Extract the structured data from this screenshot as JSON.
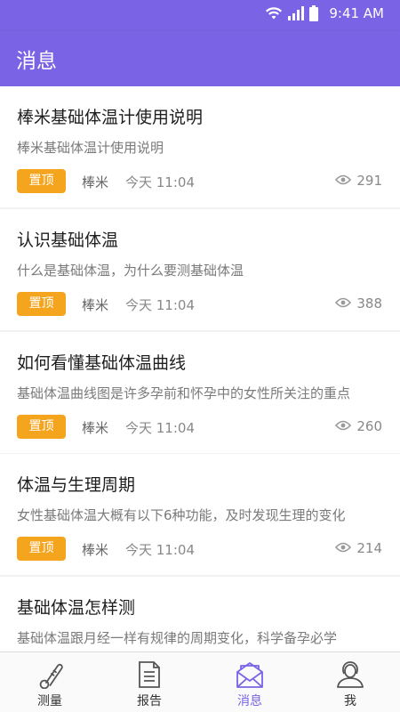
{
  "status_bar": {
    "time": "9:41 AM"
  },
  "header": {
    "title": "消息"
  },
  "articles": [
    {
      "title": "棒米基础体温计使用说明",
      "summary": "棒米基础体温计使用说明",
      "tag": "置顶",
      "author": "棒米",
      "time": "今天 11:04",
      "views": "291"
    },
    {
      "title": "认识基础体温",
      "summary": "什么是基础体温，为什么要测基础体温",
      "tag": "置顶",
      "author": "棒米",
      "time": "今天 11:04",
      "views": "388"
    },
    {
      "title": "如何看懂基础体温曲线",
      "summary": "基础体温曲线图是许多孕前和怀孕中的女性所关注的重点",
      "tag": "置顶",
      "author": "棒米",
      "time": "今天 11:04",
      "views": "260"
    },
    {
      "title": "体温与生理周期",
      "summary": "女性基础体温大概有以下6种功能，及时发现生理的变化",
      "tag": "置顶",
      "author": "棒米",
      "time": "今天 11:04",
      "views": "214"
    },
    {
      "title": "基础体温怎样测",
      "summary": "基础体温跟月经一样有规律的周期变化，科学备孕必学"
    }
  ],
  "tabs": [
    {
      "label": "测量",
      "icon": "thermometer-icon"
    },
    {
      "label": "报告",
      "icon": "report-icon"
    },
    {
      "label": "消息",
      "icon": "envelope-icon",
      "active": true
    },
    {
      "label": "我",
      "icon": "user-icon"
    }
  ],
  "colors": {
    "primary": "#7a63e4",
    "badge": "#f5a41e"
  }
}
